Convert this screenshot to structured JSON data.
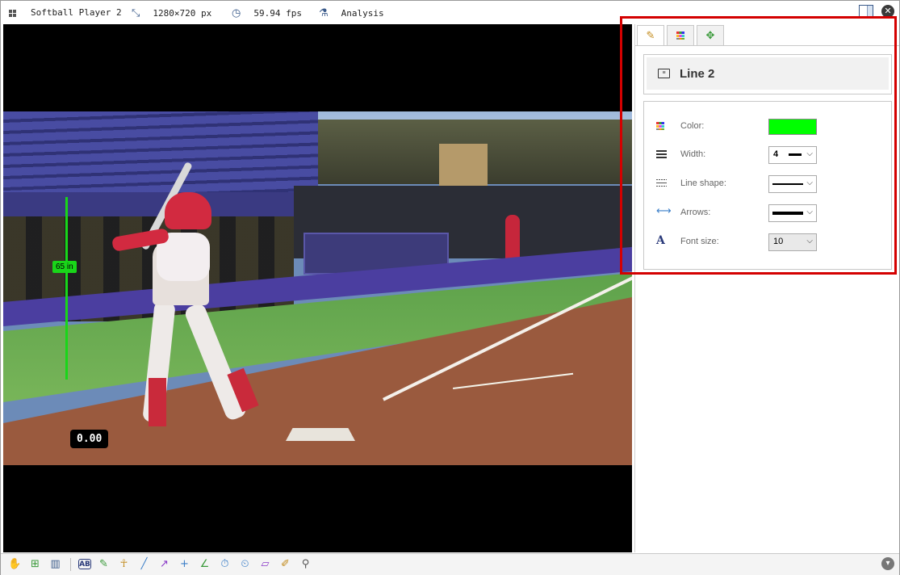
{
  "titlebar": {
    "video_name": "Softball Player 2",
    "resolution": "1280×720 px",
    "framerate": "59.94 fps",
    "mode": "Analysis"
  },
  "video": {
    "measure_label": "65 in",
    "time_label": "0.00"
  },
  "panel": {
    "tabs": [
      {
        "name": "style-tab",
        "icon": "pencil-icon"
      },
      {
        "name": "color-tab",
        "icon": "palette-icon"
      },
      {
        "name": "move-tab",
        "icon": "move-icon"
      }
    ],
    "title": "Line 2",
    "properties": {
      "color": {
        "label": "Color:",
        "value": "#00ff00"
      },
      "width": {
        "label": "Width:",
        "value": "4"
      },
      "line_shape": {
        "label": "Line shape:"
      },
      "arrows": {
        "label": "Arrows:"
      },
      "font_size": {
        "label": "Font size:",
        "value": "10"
      }
    }
  },
  "toolbar": {
    "tools": [
      "hand-icon",
      "add-keyframe-icon",
      "compare-icon",
      "text-label-icon",
      "pencil-icon",
      "human-model-icon",
      "line-icon",
      "arrow-icon",
      "crosshair-icon",
      "angle-icon",
      "chronometer-icon",
      "counter-icon",
      "grid-plane-icon",
      "magnifier-brush-icon",
      "magnifier-icon"
    ]
  },
  "colors": {
    "highlight": "#d40000",
    "accent_green": "#00ff00"
  }
}
